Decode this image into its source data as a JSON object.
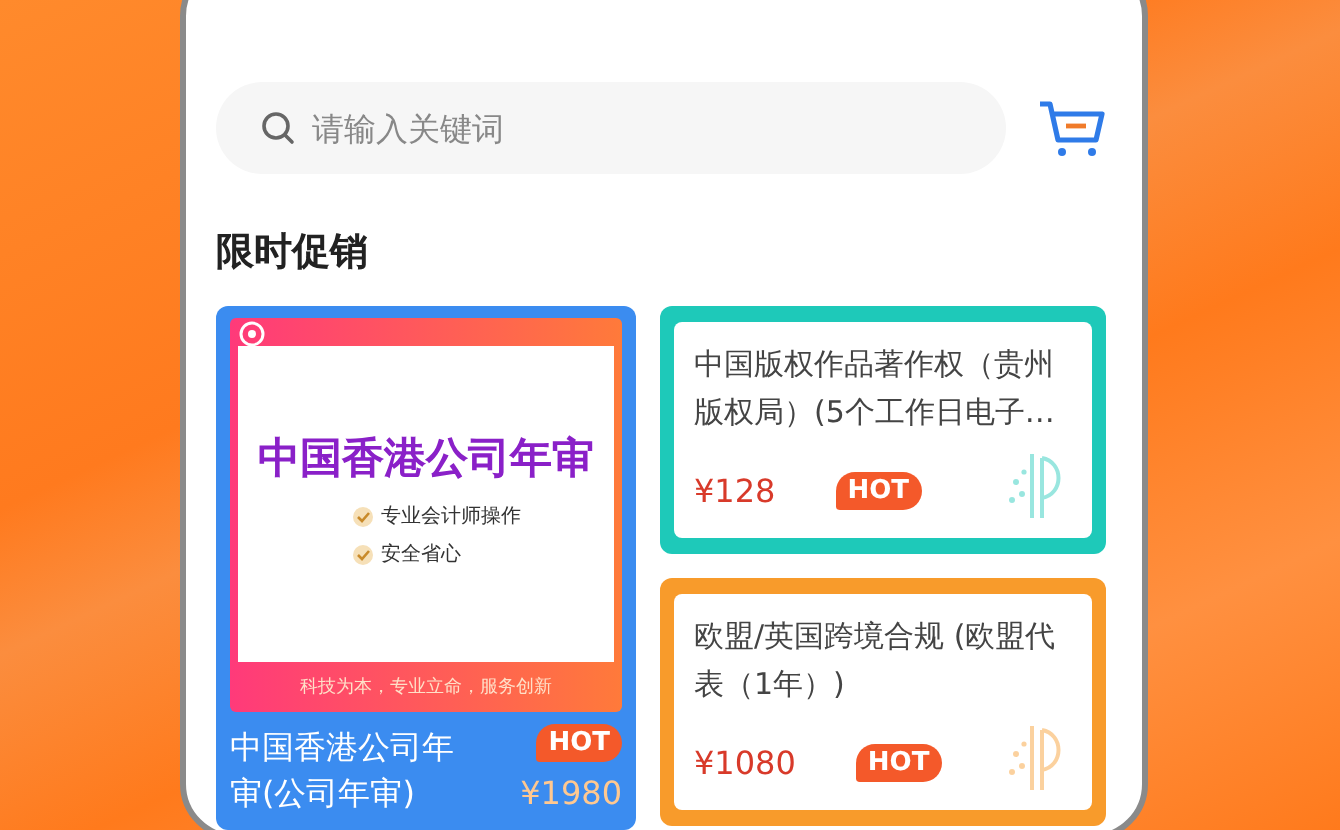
{
  "search": {
    "placeholder": "请输入关键词"
  },
  "section_title": "限时促销",
  "promotions": [
    {
      "kind": "image",
      "color": "#3b8cf0",
      "banner": {
        "headline": "中国香港公司年审",
        "points": [
          "专业会计师操作",
          "安全省心"
        ],
        "slogan": "科技为本，专业立命，服务创新"
      },
      "title": "中国香港公司年审(公司年审)",
      "badge": "HOT",
      "price": "¥1980"
    },
    {
      "kind": "text",
      "color": "#1ec9b9",
      "title": "中国版权作品著作权（贵州版权局）(5个工作日电子…",
      "badge": "HOT",
      "price": "¥128"
    },
    {
      "kind": "text",
      "color": "#f89b2b",
      "title": "欧盟/英国跨境合规 (欧盟代表（1年）)",
      "badge": "HOT",
      "price": "¥1080"
    }
  ]
}
